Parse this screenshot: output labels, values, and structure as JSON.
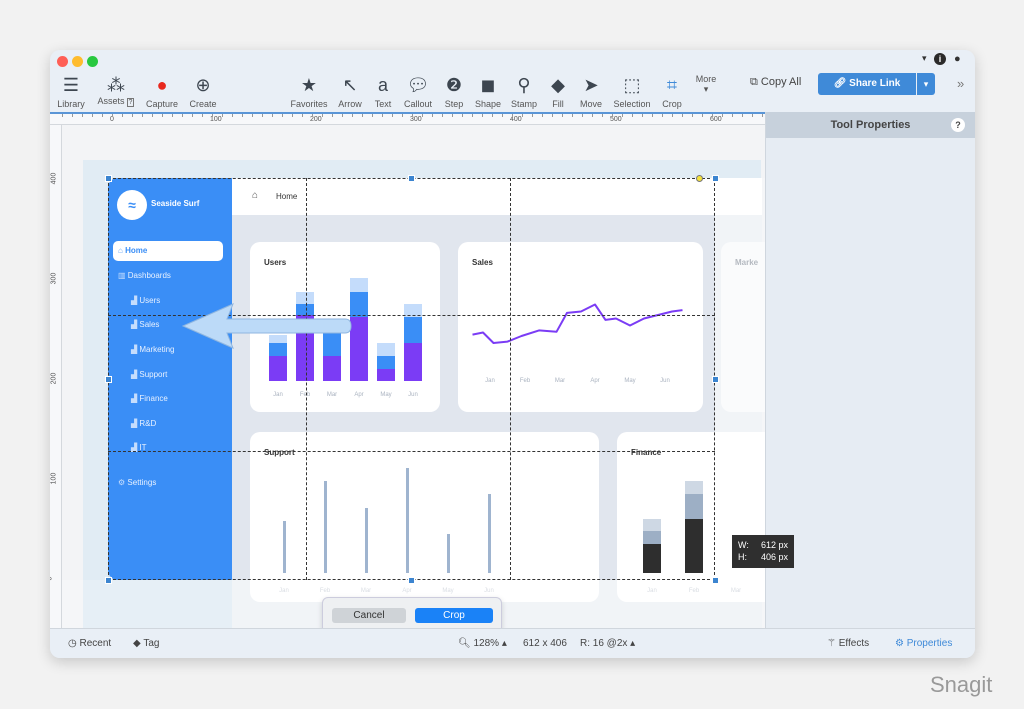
{
  "window": {
    "traffic_lights": [
      "#fe5f57",
      "#febc2e",
      "#28c840"
    ]
  },
  "toolbar": {
    "left": [
      {
        "label": "Library",
        "icon": "library-icon"
      },
      {
        "label": "Assets",
        "icon": "assets-icon",
        "badge": "?"
      },
      {
        "label": "Capture",
        "icon": "capture-icon"
      },
      {
        "label": "Create",
        "icon": "create-icon"
      }
    ],
    "tools": [
      {
        "label": "Favorites",
        "icon": "star-icon"
      },
      {
        "label": "Arrow",
        "icon": "arrow-icon"
      },
      {
        "label": "Text",
        "icon": "text-icon"
      },
      {
        "label": "Callout",
        "icon": "callout-icon"
      },
      {
        "label": "Step",
        "icon": "step-icon"
      },
      {
        "label": "Shape",
        "icon": "shape-icon"
      },
      {
        "label": "Stamp",
        "icon": "stamp-icon"
      },
      {
        "label": "Fill",
        "icon": "fill-icon"
      },
      {
        "label": "Move",
        "icon": "move-icon"
      },
      {
        "label": "Selection",
        "icon": "selection-icon"
      },
      {
        "label": "Crop",
        "icon": "crop-icon"
      }
    ],
    "more_label": "More",
    "copy_all": "Copy All",
    "share_link": "Share Link",
    "accent": "#3f8ad8"
  },
  "rulers": {
    "horizontal": [
      "0",
      "100",
      "200",
      "300",
      "400",
      "500",
      "600"
    ],
    "vertical": [
      "400",
      "300",
      "200",
      "100",
      "0"
    ]
  },
  "panel": {
    "title": "Tool Properties",
    "help": "?"
  },
  "status": {
    "recent": "Recent",
    "tag": "Tag",
    "zoom": "128%",
    "dimensions": "612 x 406",
    "resolution": "R: 16 @2x",
    "effects": "Effects",
    "properties": "Properties"
  },
  "crop": {
    "cancel": "Cancel",
    "crop": "Crop",
    "width": "W:",
    "width_value": "612 px",
    "height": "H:",
    "height_value": "406 px"
  },
  "app": {
    "brand": "Seaside Surf",
    "breadcrumb": "Home",
    "nav": [
      {
        "label": "Home",
        "active": true
      },
      {
        "label": "Dashboards"
      },
      {
        "label": "Users"
      },
      {
        "label": "Sales"
      },
      {
        "label": "Marketing"
      },
      {
        "label": "Support"
      },
      {
        "label": "Finance"
      },
      {
        "label": "R&D"
      },
      {
        "label": "IT"
      },
      {
        "label": "Settings"
      }
    ],
    "cards": {
      "users": "Users",
      "sales": "Sales",
      "marketing": "Marke",
      "support": "Support",
      "finance": "Finance"
    }
  },
  "chart_data": [
    {
      "type": "bar",
      "title": "Users",
      "stacked": true,
      "categories": [
        "Jan",
        "Feb",
        "Mar",
        "Apr",
        "May",
        "Jun"
      ],
      "series": [
        {
          "values": [
            25,
            66,
            25,
            64,
            12,
            38
          ],
          "color": "#7b3cf5"
        },
        {
          "values": [
            13,
            11,
            23,
            25,
            13,
            26
          ],
          "color": "#3a8ef6"
        },
        {
          "values": [
            8,
            12,
            8,
            14,
            13,
            13
          ],
          "color": "#c4dcfb"
        }
      ]
    },
    {
      "type": "line",
      "title": "Sales",
      "categories": [
        "Jan",
        "Feb",
        "Mar",
        "Apr",
        "May",
        "Jun"
      ],
      "x": [
        -0.5,
        -0.2,
        0.1,
        0.5,
        0.9,
        1.4,
        1.9,
        2.2,
        2.6,
        3.0,
        3.3,
        3.6,
        4.0,
        4.4,
        4.8,
        5.2,
        5.5
      ],
      "values": [
        32,
        35,
        20,
        22,
        30,
        38,
        36,
        63,
        65,
        75,
        53,
        55,
        45,
        55,
        60,
        65,
        67
      ],
      "color": "#7b3cf5"
    },
    {
      "type": "bar",
      "title": "Support",
      "categories": [
        "Jan",
        "Feb",
        "Mar",
        "Apr",
        "May",
        "Jun"
      ],
      "values": [
        52,
        92,
        65,
        105,
        39,
        79
      ],
      "color": "#9fb4cf"
    },
    {
      "type": "bar",
      "title": "Finance",
      "stacked": true,
      "categories": [
        "Jan",
        "Feb",
        "Mar"
      ],
      "series": [
        {
          "values": [
            29,
            54,
            0
          ],
          "color": "#2e2e2e"
        },
        {
          "values": [
            13,
            25,
            0
          ],
          "color": "#9dafc5"
        },
        {
          "values": [
            12,
            13,
            0
          ],
          "color": "#ced8e4"
        }
      ]
    }
  ],
  "watermark": "Snagit"
}
